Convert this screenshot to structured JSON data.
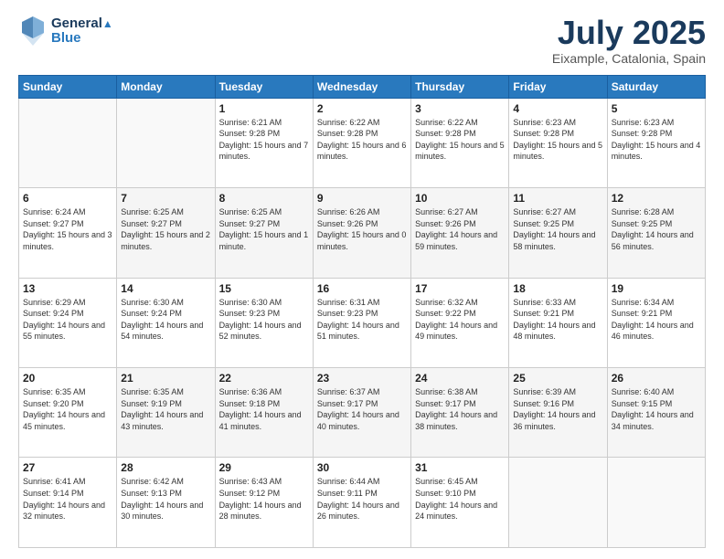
{
  "header": {
    "logo_line1": "General",
    "logo_line2": "Blue",
    "month_title": "July 2025",
    "subtitle": "Eixample, Catalonia, Spain"
  },
  "weekdays": [
    "Sunday",
    "Monday",
    "Tuesday",
    "Wednesday",
    "Thursday",
    "Friday",
    "Saturday"
  ],
  "weeks": [
    [
      {
        "day": "",
        "sunrise": "",
        "sunset": "",
        "daylight": ""
      },
      {
        "day": "",
        "sunrise": "",
        "sunset": "",
        "daylight": ""
      },
      {
        "day": "1",
        "sunrise": "Sunrise: 6:21 AM",
        "sunset": "Sunset: 9:28 PM",
        "daylight": "Daylight: 15 hours and 7 minutes."
      },
      {
        "day": "2",
        "sunrise": "Sunrise: 6:22 AM",
        "sunset": "Sunset: 9:28 PM",
        "daylight": "Daylight: 15 hours and 6 minutes."
      },
      {
        "day": "3",
        "sunrise": "Sunrise: 6:22 AM",
        "sunset": "Sunset: 9:28 PM",
        "daylight": "Daylight: 15 hours and 5 minutes."
      },
      {
        "day": "4",
        "sunrise": "Sunrise: 6:23 AM",
        "sunset": "Sunset: 9:28 PM",
        "daylight": "Daylight: 15 hours and 5 minutes."
      },
      {
        "day": "5",
        "sunrise": "Sunrise: 6:23 AM",
        "sunset": "Sunset: 9:28 PM",
        "daylight": "Daylight: 15 hours and 4 minutes."
      }
    ],
    [
      {
        "day": "6",
        "sunrise": "Sunrise: 6:24 AM",
        "sunset": "Sunset: 9:27 PM",
        "daylight": "Daylight: 15 hours and 3 minutes."
      },
      {
        "day": "7",
        "sunrise": "Sunrise: 6:25 AM",
        "sunset": "Sunset: 9:27 PM",
        "daylight": "Daylight: 15 hours and 2 minutes."
      },
      {
        "day": "8",
        "sunrise": "Sunrise: 6:25 AM",
        "sunset": "Sunset: 9:27 PM",
        "daylight": "Daylight: 15 hours and 1 minute."
      },
      {
        "day": "9",
        "sunrise": "Sunrise: 6:26 AM",
        "sunset": "Sunset: 9:26 PM",
        "daylight": "Daylight: 15 hours and 0 minutes."
      },
      {
        "day": "10",
        "sunrise": "Sunrise: 6:27 AM",
        "sunset": "Sunset: 9:26 PM",
        "daylight": "Daylight: 14 hours and 59 minutes."
      },
      {
        "day": "11",
        "sunrise": "Sunrise: 6:27 AM",
        "sunset": "Sunset: 9:25 PM",
        "daylight": "Daylight: 14 hours and 58 minutes."
      },
      {
        "day": "12",
        "sunrise": "Sunrise: 6:28 AM",
        "sunset": "Sunset: 9:25 PM",
        "daylight": "Daylight: 14 hours and 56 minutes."
      }
    ],
    [
      {
        "day": "13",
        "sunrise": "Sunrise: 6:29 AM",
        "sunset": "Sunset: 9:24 PM",
        "daylight": "Daylight: 14 hours and 55 minutes."
      },
      {
        "day": "14",
        "sunrise": "Sunrise: 6:30 AM",
        "sunset": "Sunset: 9:24 PM",
        "daylight": "Daylight: 14 hours and 54 minutes."
      },
      {
        "day": "15",
        "sunrise": "Sunrise: 6:30 AM",
        "sunset": "Sunset: 9:23 PM",
        "daylight": "Daylight: 14 hours and 52 minutes."
      },
      {
        "day": "16",
        "sunrise": "Sunrise: 6:31 AM",
        "sunset": "Sunset: 9:23 PM",
        "daylight": "Daylight: 14 hours and 51 minutes."
      },
      {
        "day": "17",
        "sunrise": "Sunrise: 6:32 AM",
        "sunset": "Sunset: 9:22 PM",
        "daylight": "Daylight: 14 hours and 49 minutes."
      },
      {
        "day": "18",
        "sunrise": "Sunrise: 6:33 AM",
        "sunset": "Sunset: 9:21 PM",
        "daylight": "Daylight: 14 hours and 48 minutes."
      },
      {
        "day": "19",
        "sunrise": "Sunrise: 6:34 AM",
        "sunset": "Sunset: 9:21 PM",
        "daylight": "Daylight: 14 hours and 46 minutes."
      }
    ],
    [
      {
        "day": "20",
        "sunrise": "Sunrise: 6:35 AM",
        "sunset": "Sunset: 9:20 PM",
        "daylight": "Daylight: 14 hours and 45 minutes."
      },
      {
        "day": "21",
        "sunrise": "Sunrise: 6:35 AM",
        "sunset": "Sunset: 9:19 PM",
        "daylight": "Daylight: 14 hours and 43 minutes."
      },
      {
        "day": "22",
        "sunrise": "Sunrise: 6:36 AM",
        "sunset": "Sunset: 9:18 PM",
        "daylight": "Daylight: 14 hours and 41 minutes."
      },
      {
        "day": "23",
        "sunrise": "Sunrise: 6:37 AM",
        "sunset": "Sunset: 9:17 PM",
        "daylight": "Daylight: 14 hours and 40 minutes."
      },
      {
        "day": "24",
        "sunrise": "Sunrise: 6:38 AM",
        "sunset": "Sunset: 9:17 PM",
        "daylight": "Daylight: 14 hours and 38 minutes."
      },
      {
        "day": "25",
        "sunrise": "Sunrise: 6:39 AM",
        "sunset": "Sunset: 9:16 PM",
        "daylight": "Daylight: 14 hours and 36 minutes."
      },
      {
        "day": "26",
        "sunrise": "Sunrise: 6:40 AM",
        "sunset": "Sunset: 9:15 PM",
        "daylight": "Daylight: 14 hours and 34 minutes."
      }
    ],
    [
      {
        "day": "27",
        "sunrise": "Sunrise: 6:41 AM",
        "sunset": "Sunset: 9:14 PM",
        "daylight": "Daylight: 14 hours and 32 minutes."
      },
      {
        "day": "28",
        "sunrise": "Sunrise: 6:42 AM",
        "sunset": "Sunset: 9:13 PM",
        "daylight": "Daylight: 14 hours and 30 minutes."
      },
      {
        "day": "29",
        "sunrise": "Sunrise: 6:43 AM",
        "sunset": "Sunset: 9:12 PM",
        "daylight": "Daylight: 14 hours and 28 minutes."
      },
      {
        "day": "30",
        "sunrise": "Sunrise: 6:44 AM",
        "sunset": "Sunset: 9:11 PM",
        "daylight": "Daylight: 14 hours and 26 minutes."
      },
      {
        "day": "31",
        "sunrise": "Sunrise: 6:45 AM",
        "sunset": "Sunset: 9:10 PM",
        "daylight": "Daylight: 14 hours and 24 minutes."
      },
      {
        "day": "",
        "sunrise": "",
        "sunset": "",
        "daylight": ""
      },
      {
        "day": "",
        "sunrise": "",
        "sunset": "",
        "daylight": ""
      }
    ]
  ]
}
